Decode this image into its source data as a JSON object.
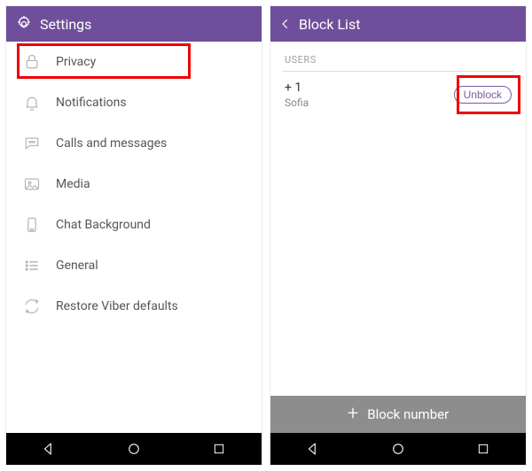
{
  "left": {
    "header": {
      "title": "Settings"
    },
    "items": [
      {
        "label": "Privacy"
      },
      {
        "label": "Notifications"
      },
      {
        "label": "Calls and messages"
      },
      {
        "label": "Media"
      },
      {
        "label": "Chat Background"
      },
      {
        "label": "General"
      },
      {
        "label": "Restore Viber defaults"
      }
    ]
  },
  "right": {
    "header": {
      "title": "Block List"
    },
    "sectionLabel": "USERS",
    "user": {
      "number": "+       1",
      "name": "Sofia",
      "unblockLabel": "Unblock"
    },
    "blockNumberLabel": "Block number"
  }
}
